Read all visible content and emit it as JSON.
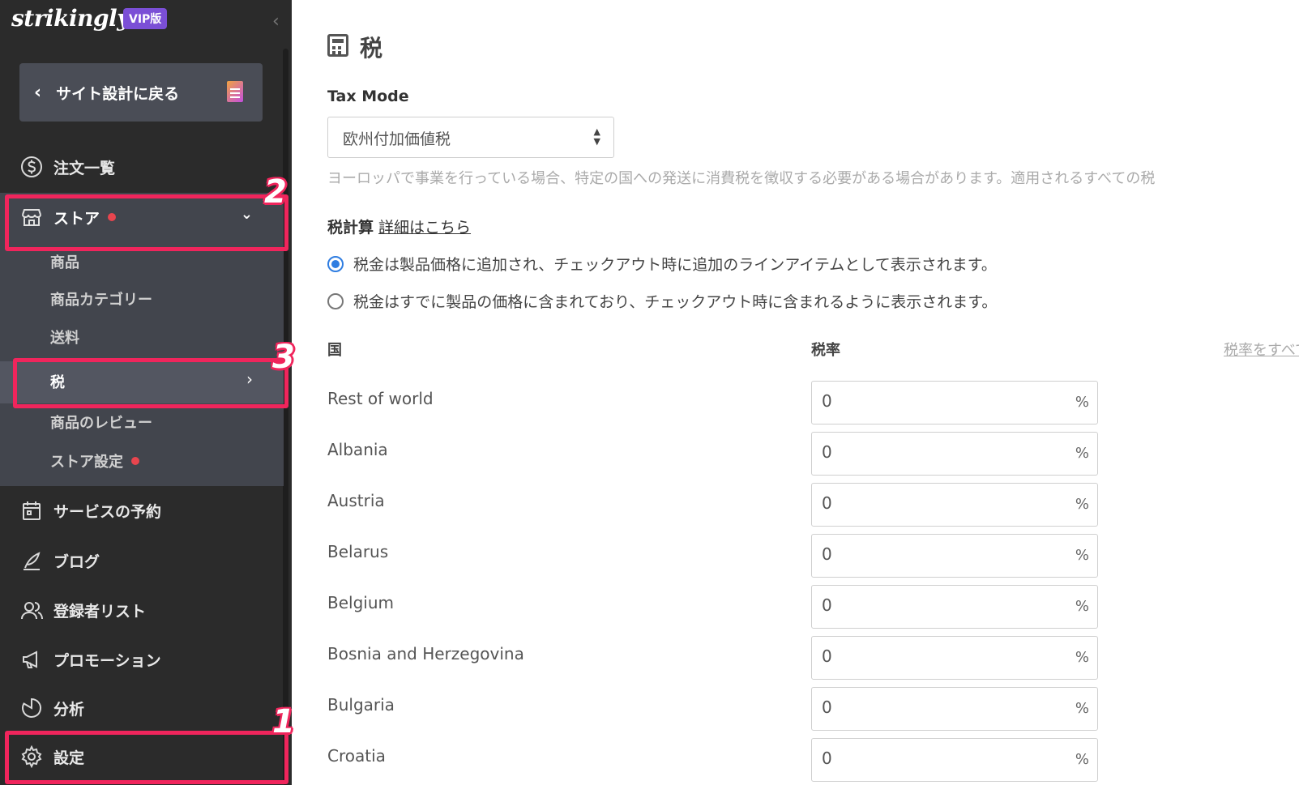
{
  "sidebar": {
    "logo": "strikingly",
    "vip_badge": "VIP版",
    "collapse_icon": "chevron-left-icon",
    "back_button": "サイト設計に戻る",
    "orders": "注文一覧",
    "store": "ストア",
    "store_sub": {
      "products": "商品",
      "categories": "商品カテゴリー",
      "shipping": "送料",
      "tax": "税",
      "reviews": "商品のレビュー",
      "store_settings": "ストア設定"
    },
    "bookings": "サービスの予約",
    "blog": "ブログ",
    "subscribers": "登録者リスト",
    "promotions": "プロモーション",
    "analytics": "分析",
    "settings": "設定"
  },
  "annotations": {
    "one": "1",
    "two": "2",
    "three": "3"
  },
  "colors": {
    "annotation": "#f0255c",
    "accent": "#2f7de1",
    "sidebar_bg": "#2b2b2b"
  },
  "main": {
    "title": "税",
    "tax_mode_label": "Tax Mode",
    "tax_mode_value": "欧州付加価値税",
    "tax_mode_help": "ヨーロッパで事業を行っている場合、特定の国への発送に消費税を徴収する必要がある場合があります。適用されるすべての税",
    "calc_label": "税計算",
    "calc_link": "詳細はこちら",
    "radio_added": "税金は製品価格に追加され、チェックアウト時に追加のラインアイテムとして表示されます。",
    "radio_included": "税金はすでに製品の価格に含まれており、チェックアウト時に含まれるように表示されます。",
    "col_country": "国",
    "col_rate": "税率",
    "set_all": "税率をすべて",
    "pct": "%",
    "rows": [
      {
        "country": "Rest of world",
        "rate": "0"
      },
      {
        "country": "Albania",
        "rate": "0"
      },
      {
        "country": "Austria",
        "rate": "0"
      },
      {
        "country": "Belarus",
        "rate": "0"
      },
      {
        "country": "Belgium",
        "rate": "0"
      },
      {
        "country": "Bosnia and Herzegovina",
        "rate": "0"
      },
      {
        "country": "Bulgaria",
        "rate": "0"
      },
      {
        "country": "Croatia",
        "rate": "0"
      }
    ]
  }
}
